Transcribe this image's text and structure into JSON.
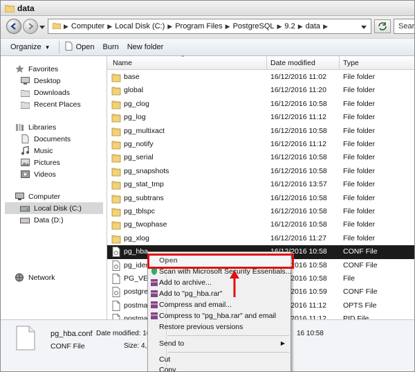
{
  "window": {
    "title": "data"
  },
  "address": {
    "crumbs": [
      "Computer",
      "Local Disk (C:)",
      "Program Files",
      "PostgreSQL",
      "9.2",
      "data"
    ],
    "search_placeholder": "Sear"
  },
  "toolbar": {
    "organize": "Organize",
    "open": "Open",
    "burn": "Burn",
    "new_folder": "New folder"
  },
  "nav": {
    "favorites": "Favorites",
    "desktop": "Desktop",
    "downloads": "Downloads",
    "recent": "Recent Places",
    "libraries": "Libraries",
    "documents": "Documents",
    "music": "Music",
    "pictures": "Pictures",
    "videos": "Videos",
    "computer": "Computer",
    "local_disk": "Local Disk (C:)",
    "data_disk": "Data (D:)",
    "network": "Network"
  },
  "columns": {
    "name": "Name",
    "date": "Date modified",
    "type": "Type"
  },
  "files": [
    {
      "name": "base",
      "date": "16/12/2016 11:02",
      "type": "File folder",
      "icon": "folder-icon"
    },
    {
      "name": "global",
      "date": "16/12/2016 11:20",
      "type": "File folder",
      "icon": "folder-icon"
    },
    {
      "name": "pg_clog",
      "date": "16/12/2016 10:58",
      "type": "File folder",
      "icon": "folder-icon"
    },
    {
      "name": "pg_log",
      "date": "16/12/2016 11:12",
      "type": "File folder",
      "icon": "folder-icon"
    },
    {
      "name": "pg_multixact",
      "date": "16/12/2016 10:58",
      "type": "File folder",
      "icon": "folder-icon"
    },
    {
      "name": "pg_notify",
      "date": "16/12/2016 11:12",
      "type": "File folder",
      "icon": "folder-icon"
    },
    {
      "name": "pg_serial",
      "date": "16/12/2016 10:58",
      "type": "File folder",
      "icon": "folder-icon"
    },
    {
      "name": "pg_snapshots",
      "date": "16/12/2016 10:58",
      "type": "File folder",
      "icon": "folder-icon"
    },
    {
      "name": "pg_stat_tmp",
      "date": "16/12/2016 13:57",
      "type": "File folder",
      "icon": "folder-icon"
    },
    {
      "name": "pg_subtrans",
      "date": "16/12/2016 10:58",
      "type": "File folder",
      "icon": "folder-icon"
    },
    {
      "name": "pg_tblspc",
      "date": "16/12/2016 10:58",
      "type": "File folder",
      "icon": "folder-icon"
    },
    {
      "name": "pg_twophase",
      "date": "16/12/2016 10:58",
      "type": "File folder",
      "icon": "folder-icon"
    },
    {
      "name": "pg_xlog",
      "date": "16/12/2016 11:27",
      "type": "File folder",
      "icon": "folder-icon"
    },
    {
      "name": "pg_hba",
      "date": "16/12/2016 10:58",
      "type": "CONF File",
      "icon": "conf-file-icon",
      "selected": true
    },
    {
      "name": "pg_iden",
      "date": "16/12/2016 10:58",
      "type": "CONF File",
      "icon": "conf-file-icon"
    },
    {
      "name": "PG_VER",
      "date": "16/12/2016 10:58",
      "type": "File",
      "icon": "file-icon"
    },
    {
      "name": "postgres",
      "date": "16/12/2016 10:59",
      "type": "CONF File",
      "icon": "conf-file-icon"
    },
    {
      "name": "postmas",
      "date": "16/12/2016 11:12",
      "type": "OPTS File",
      "icon": "file-icon"
    },
    {
      "name": "postmas",
      "date": "16/12/2016 11:12",
      "type": "PID File",
      "icon": "file-icon"
    }
  ],
  "details": {
    "file_name": "pg_hba.conf",
    "file_type": "CONF File",
    "date_modified": "Date modified: 16",
    "size": "Size: 4,",
    "time": "16 10:58"
  },
  "context_menu": {
    "open": "Open",
    "scan": "Scan with Microsoft Security Essentials...",
    "add_archive": "Add to archive...",
    "add_rar": "Add to \"pg_hba.rar\"",
    "compress_email": "Compress and email...",
    "compress_rar_email": "Compress to \"pg_hba.rar\" and email",
    "restore": "Restore previous versions",
    "send_to": "Send to",
    "cut": "Cut",
    "copy": "Copy"
  },
  "colors": {
    "highlight_box": "#e01010",
    "selected_row": "#1b1b1b",
    "folder": "#f2d27a"
  }
}
